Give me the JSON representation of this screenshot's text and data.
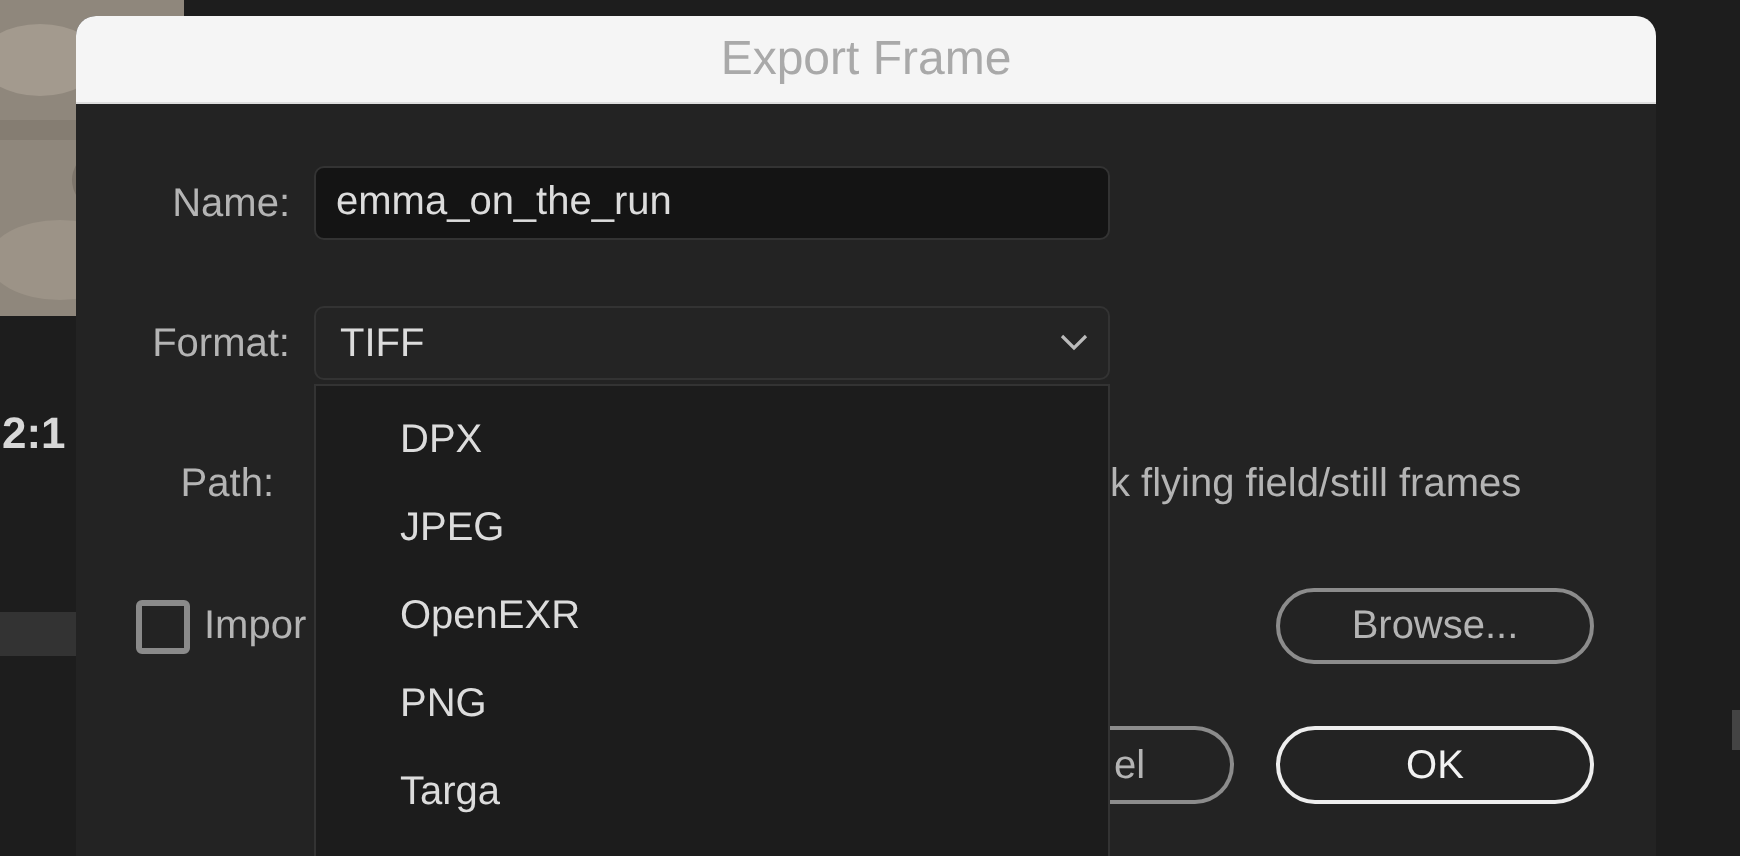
{
  "background": {
    "timecode": "2:1"
  },
  "dialog": {
    "title": "Export Frame",
    "name": {
      "label": "Name:",
      "value": "emma_on_the_run"
    },
    "format": {
      "label": "Format:",
      "value": "TIFF",
      "expanded": true,
      "options": [
        {
          "label": "DPX",
          "selected": false
        },
        {
          "label": "JPEG",
          "selected": false
        },
        {
          "label": "OpenEXR",
          "selected": false
        },
        {
          "label": "PNG",
          "selected": false
        },
        {
          "label": "Targa",
          "selected": false
        }
      ]
    },
    "path": {
      "label": "Path:",
      "value": "k flying field/still frames"
    },
    "import_checkbox": {
      "label": "Impor",
      "checked": false
    },
    "browse_button": "Browse...",
    "cancel_button": "el",
    "ok_button": "OK"
  }
}
